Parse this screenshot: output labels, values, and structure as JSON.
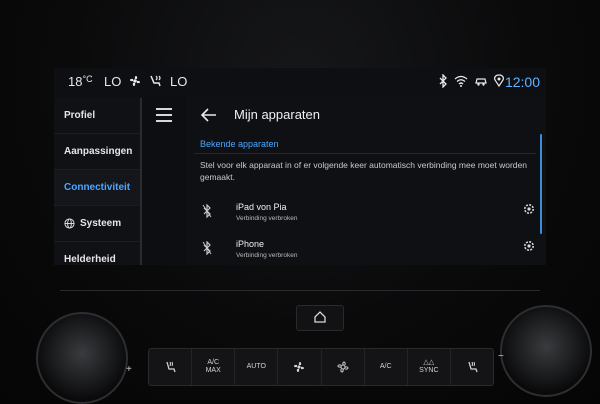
{
  "status_bar": {
    "temp": "18",
    "temp_unit": "°C",
    "fan_left": "LO",
    "fan_right": "LO",
    "time": "12:00"
  },
  "sidebar": {
    "items": [
      {
        "label": "Profiel"
      },
      {
        "label": "Aanpassingen"
      },
      {
        "label": "Connectiviteit"
      },
      {
        "label": "Systeem"
      },
      {
        "label": "Helderheid"
      }
    ]
  },
  "content": {
    "title": "Mijn apparaten",
    "section": "Bekende apparaten",
    "description": "Stel voor elk apparaat in of er volgende keer automatisch verbinding mee moet worden gemaakt.",
    "devices": [
      {
        "name": "iPad von Pia",
        "status": "Verbinding verbroken"
      },
      {
        "name": "iPhone",
        "status": "Verbinding verbroken"
      }
    ]
  },
  "console": {
    "plus": "+",
    "minus": "−",
    "buttons": [
      {
        "label": ""
      },
      {
        "label": "A/C\nMAX"
      },
      {
        "label": "AUTO"
      },
      {
        "label": ""
      },
      {
        "label": ""
      },
      {
        "label": "A/C"
      },
      {
        "label": "SYNC"
      },
      {
        "label": ""
      }
    ]
  },
  "colors": {
    "accent": "#4aa7ff",
    "time": "#5fb3ff"
  }
}
